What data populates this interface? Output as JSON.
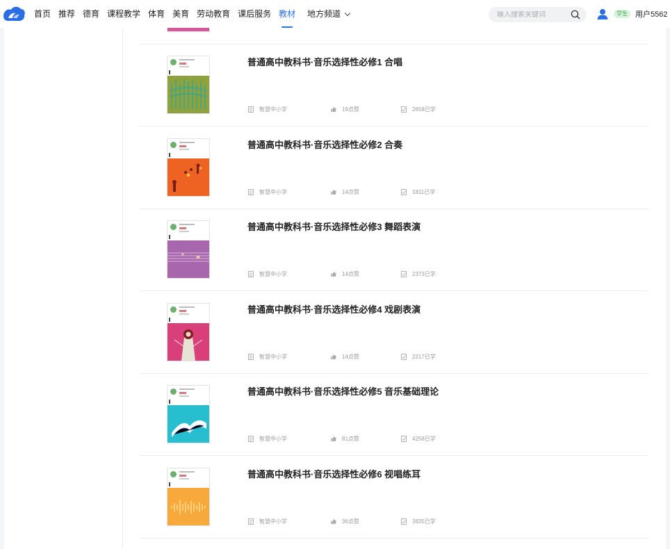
{
  "nav": {
    "items": [
      "首页",
      "推荐",
      "德育",
      "课程教学",
      "体育",
      "美育",
      "劳动教育",
      "课后服务",
      "教材"
    ],
    "active_index": 8,
    "local_channel": "地方频道"
  },
  "search": {
    "placeholder": "输入搜索关键词"
  },
  "user": {
    "role_badge": "学生",
    "name": "用户5562"
  },
  "colors": {
    "accent": "#2b6de5",
    "badge_bg": "#d8f2dc",
    "badge_text": "#46a85a"
  },
  "books": [
    {
      "title": "普通高中教科书·音乐选择性必修1 合唱",
      "publisher": "智慧中小学",
      "likes": "19点赞",
      "learned": "2658已学",
      "cover_color": "#8ea23e"
    },
    {
      "title": "普通高中教科书·音乐选择性必修2 合奏",
      "publisher": "智慧中小学",
      "likes": "14点赞",
      "learned": "1811已学",
      "cover_color": "#ee6322"
    },
    {
      "title": "普通高中教科书·音乐选择性必修3 舞蹈表演",
      "publisher": "智慧中小学",
      "likes": "14点赞",
      "learned": "2373已学",
      "cover_color": "#a866ad"
    },
    {
      "title": "普通高中教科书·音乐选择性必修4 戏剧表演",
      "publisher": "智慧中小学",
      "likes": "14点赞",
      "learned": "2217已学",
      "cover_color": "#d9407a"
    },
    {
      "title": "普通高中教科书·音乐选择性必修5 音乐基础理论",
      "publisher": "智慧中小学",
      "likes": "81点赞",
      "learned": "4258已学",
      "cover_color": "#27bfd0"
    },
    {
      "title": "普通高中教科书·音乐选择性必修6 视唱练耳",
      "publisher": "智慧中小学",
      "likes": "36点赞",
      "learned": "3835已学",
      "cover_color": "#f7a93b"
    }
  ]
}
